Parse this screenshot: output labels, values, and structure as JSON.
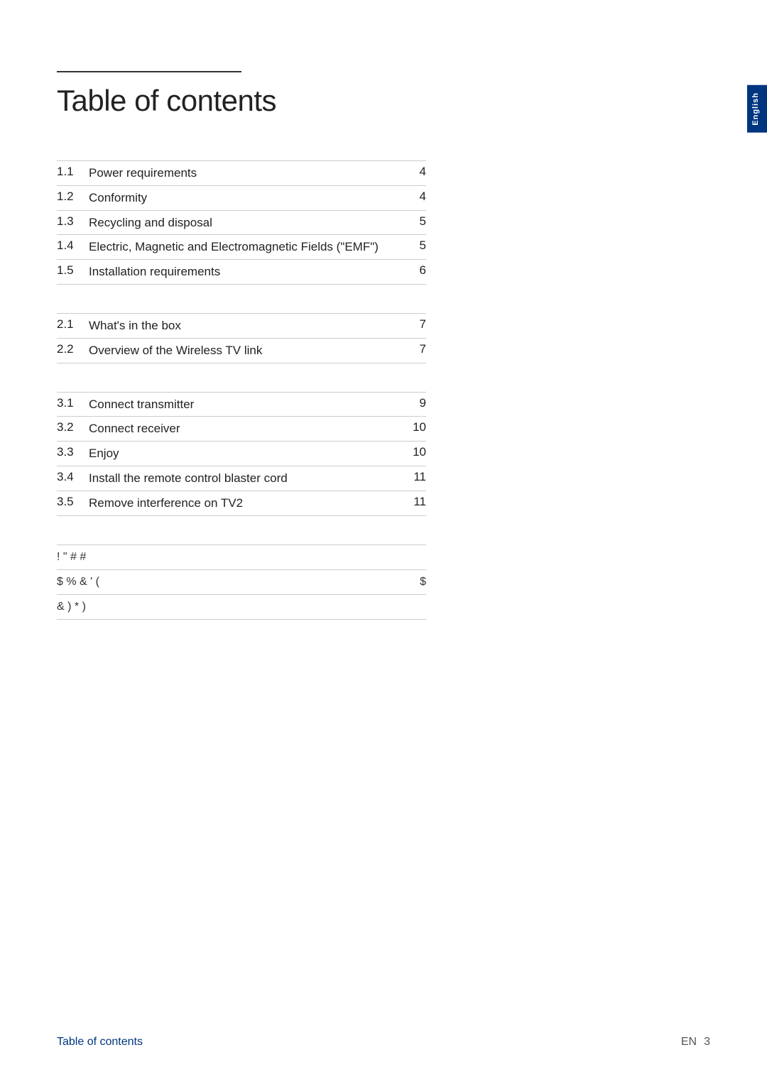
{
  "page": {
    "title": "Table of contents",
    "side_tab_label": "English"
  },
  "sections": [
    {
      "id": "section1",
      "items": [
        {
          "num": "1.1",
          "title": "Power requirements",
          "page": "4"
        },
        {
          "num": "1.2",
          "title": "Conformity",
          "page": "4"
        },
        {
          "num": "1.3",
          "title": "Recycling and disposal",
          "page": "5"
        },
        {
          "num": "1.4",
          "title": "Electric, Magnetic and Electromagnetic Fields (\"EMF\")",
          "page": "5"
        },
        {
          "num": "1.5",
          "title": "Installation requirements",
          "page": "6"
        }
      ]
    },
    {
      "id": "section2",
      "items": [
        {
          "num": "2.1",
          "title": "What's in the box",
          "page": "7"
        },
        {
          "num": "2.2",
          "title": "Overview of the Wireless TV link",
          "page": "7"
        }
      ]
    },
    {
      "id": "section3",
      "items": [
        {
          "num": "3.1",
          "title": "Connect transmitter",
          "page": "9"
        },
        {
          "num": "3.2",
          "title": "Connect receiver",
          "page": "10"
        },
        {
          "num": "3.3",
          "title": "Enjoy",
          "page": "10"
        },
        {
          "num": "3.4",
          "title": "Install the remote control blaster cord",
          "page": "11"
        },
        {
          "num": "3.5",
          "title": "Remove interference on TV2",
          "page": "11"
        }
      ]
    }
  ],
  "garbled_section": {
    "line1_left": "!    \"    #                    #",
    "line1_right": "",
    "line2_left": "$      % & ' (",
    "line2_right": "$",
    "line3_left": "       &                  )   *   )",
    "line3_right": ""
  },
  "footer": {
    "toc_label": "Table of contents",
    "lang_label": "EN",
    "page_number": "3"
  }
}
